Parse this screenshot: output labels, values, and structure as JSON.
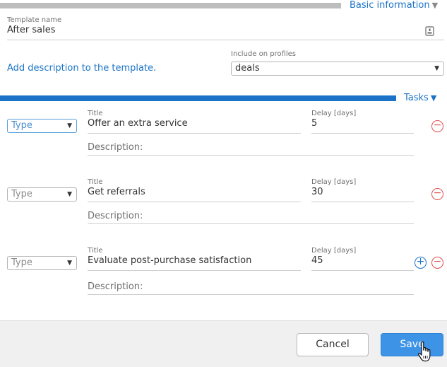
{
  "basic_section": {
    "title": "Basic information"
  },
  "template_name": {
    "label": "Template name",
    "value": "After sales"
  },
  "add_description_link": "Add description to the template.",
  "include_on_profiles": {
    "label": "Include on profiles",
    "value": "deals"
  },
  "tasks_section": {
    "title": "Tasks"
  },
  "tasks": [
    {
      "type_placeholder": "Type",
      "title_label": "Title",
      "title": "Offer an extra service",
      "delay_label": "Delay [days]",
      "delay": "5",
      "description_placeholder": "Description:"
    },
    {
      "type_placeholder": "Type",
      "title_label": "Title",
      "title": "Get referrals",
      "delay_label": "Delay [days]",
      "delay": "30",
      "description_placeholder": "Description:"
    },
    {
      "type_placeholder": "Type",
      "title_label": "Title",
      "title": "Evaluate post-purchase satisfaction",
      "delay_label": "Delay [days]",
      "delay": "45",
      "description_placeholder": "Description:"
    }
  ],
  "footer": {
    "cancel_label": "Cancel",
    "save_label": "Save"
  },
  "icons": {
    "template_icon": "document-icon",
    "remove_icon": "minus-circle-icon",
    "add_icon": "plus-circle-icon",
    "cursor_icon": "hand-pointer-icon"
  },
  "colors": {
    "accent": "#1a73c6",
    "danger": "#e05050",
    "save_button": "#3d93e6"
  }
}
